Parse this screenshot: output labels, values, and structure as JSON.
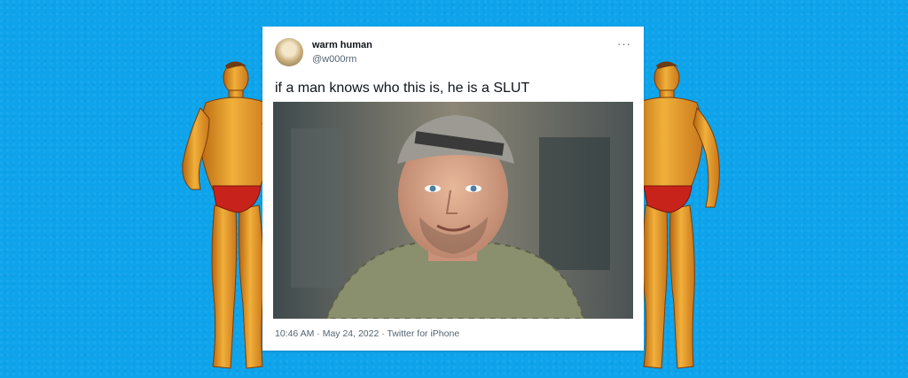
{
  "tweet": {
    "display_name": "warm human",
    "handle": "@w000rm",
    "more_label": "···",
    "text": "if a man knows who this is, he is a SLUT",
    "timestamp": "10:46 AM · May 24, 2022 · Twitter for iPhone"
  },
  "colors": {
    "background": "#0ea4ec",
    "card": "#ffffff",
    "text_primary": "#0f1419",
    "text_secondary": "#536471"
  },
  "icons": {
    "more": "ellipsis-icon"
  }
}
